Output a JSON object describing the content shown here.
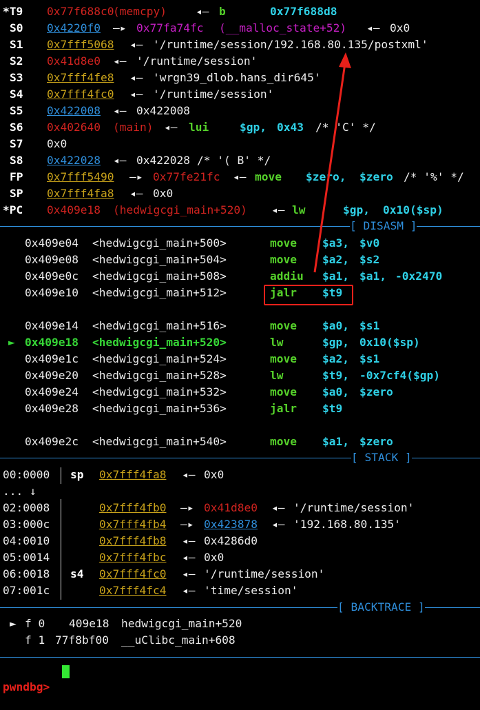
{
  "registers": [
    {
      "name": "*T9",
      "addr": "0x77f688c0",
      "desc": "(memcpy)",
      "arrow": "◂—",
      "instr": "b",
      "target": "0x77f688d8"
    },
    {
      "name": "S0",
      "addr": "0x4220f0",
      "arrow1": "—▸",
      "ptr": "0x77fa74fc",
      "desc": "(__malloc_state+52)",
      "arrow2": "◂—",
      "val": "0x0"
    },
    {
      "name": "S1",
      "addr": "0x7fff5068",
      "arrow": "◂—",
      "val": "'/runtime/session/192.168.80.135/postxml'"
    },
    {
      "name": "S2",
      "addr": "0x41d8e0",
      "arrow": "◂—",
      "val": "'/runtime/session'"
    },
    {
      "name": "S3",
      "addr": "0x7fff4fe8",
      "arrow": "◂—",
      "val": "'wrgn39_dlob.hans_dir645'"
    },
    {
      "name": "S4",
      "addr": "0x7fff4fc0",
      "arrow": "◂—",
      "val": "'/runtime/session'"
    },
    {
      "name": "S5",
      "addr": "0x422008",
      "arrow": "◂—",
      "val": "0x422008"
    },
    {
      "name": "S6",
      "addr": "0x402640",
      "desc": "(main)",
      "arrow": "◂—",
      "instr": "lui",
      "op1": "$gp,",
      "op2": "0x43",
      "comment": "/* 'C' */"
    },
    {
      "name": "S7",
      "val": "0x0"
    },
    {
      "name": "S8",
      "addr": "0x422028",
      "arrow": "◂—",
      "val": "0x422028",
      "comment": "/* '( B' */"
    },
    {
      "name": "FP",
      "addr": "0x7fff5490",
      "arrow1": "—▸",
      "ptr": "0x77fe21fc",
      "arrow2": "◂—",
      "instr": "move",
      "op1": "$zero,",
      "op2": "$zero",
      "comment": "/* '%' */"
    },
    {
      "name": "SP",
      "addr": "0x7fff4fa8",
      "arrow": "◂—",
      "val": "0x0"
    },
    {
      "name": "*PC",
      "addr": "0x409e18",
      "desc": "(hedwigcgi_main+520)",
      "arrow": "◂—",
      "instr": "lw",
      "op1": "$gp,",
      "op2": "0x10($sp)"
    }
  ],
  "sections": {
    "disasm": "[ DISASM ]",
    "stack": "[ STACK ]",
    "backtrace": "[ BACKTRACE ]"
  },
  "disasm": [
    {
      "marker": "",
      "addr": "0x409e04",
      "sym": "<hedwigcgi_main+500>",
      "op": "move",
      "a1": "$a3,",
      "a2": "$v0",
      "a3": ""
    },
    {
      "marker": "",
      "addr": "0x409e08",
      "sym": "<hedwigcgi_main+504>",
      "op": "move",
      "a1": "$a2,",
      "a2": "$s2",
      "a3": ""
    },
    {
      "marker": "",
      "addr": "0x409e0c",
      "sym": "<hedwigcgi_main+508>",
      "op": "addiu",
      "a1": "$a1,",
      "a2": "$a1,",
      "a3": "-0x2470"
    },
    {
      "marker": "",
      "addr": "0x409e10",
      "sym": "<hedwigcgi_main+512>",
      "op": "jalr",
      "a1": "$t9",
      "a2": "",
      "a3": ""
    },
    {
      "marker": "",
      "addr": "0x409e14",
      "sym": "<hedwigcgi_main+516>",
      "op": "move",
      "a1": "$a0,",
      "a2": "$s1",
      "a3": ""
    },
    {
      "marker": "►",
      "addr": "0x409e18",
      "sym": "<hedwigcgi_main+520>",
      "op": "lw",
      "a1": "$gp,",
      "a2": "0x10($sp)",
      "a3": ""
    },
    {
      "marker": "",
      "addr": "0x409e1c",
      "sym": "<hedwigcgi_main+524>",
      "op": "move",
      "a1": "$a2,",
      "a2": "$s1",
      "a3": ""
    },
    {
      "marker": "",
      "addr": "0x409e20",
      "sym": "<hedwigcgi_main+528>",
      "op": "lw",
      "a1": "$t9,",
      "a2": "-0x7cf4($gp)",
      "a3": ""
    },
    {
      "marker": "",
      "addr": "0x409e24",
      "sym": "<hedwigcgi_main+532>",
      "op": "move",
      "a1": "$a0,",
      "a2": "$zero",
      "a3": ""
    },
    {
      "marker": "",
      "addr": "0x409e28",
      "sym": "<hedwigcgi_main+536>",
      "op": "jalr",
      "a1": "$t9",
      "a2": "",
      "a3": ""
    },
    {
      "marker": "",
      "addr": "0x409e2c",
      "sym": "<hedwigcgi_main+540>",
      "op": "move",
      "a1": "$a1,",
      "a2": "$zero",
      "a3": ""
    }
  ],
  "stack": [
    {
      "off": "00:0000",
      "reg": "sp",
      "addr": "0x7fff4fa8",
      "arrow": "◂—",
      "val": "0x0"
    },
    {
      "skip": "... ↓"
    },
    {
      "off": "02:0008",
      "reg": "",
      "addr": "0x7fff4fb0",
      "arrow1": "—▸",
      "ptr": "0x41d8e0",
      "arrow2": "◂—",
      "val": "'/runtime/session'"
    },
    {
      "off": "03:000c",
      "reg": "",
      "addr": "0x7fff4fb4",
      "arrow1": "—▸",
      "ptr": "0x423878",
      "arrow2": "◂—",
      "val": "'192.168.80.135'"
    },
    {
      "off": "04:0010",
      "reg": "",
      "addr": "0x7fff4fb8",
      "arrow": "◂—",
      "val": "0x4286d0"
    },
    {
      "off": "05:0014",
      "reg": "",
      "addr": "0x7fff4fbc",
      "arrow": "◂—",
      "val": "0x0"
    },
    {
      "off": "06:0018",
      "reg": "s4",
      "addr": "0x7fff4fc0",
      "arrow": "◂—",
      "val": "'/runtime/session'"
    },
    {
      "off": "07:001c",
      "reg": "",
      "addr": "0x7fff4fc4",
      "arrow": "◂—",
      "val": "'time/session'"
    }
  ],
  "backtrace": [
    {
      "marker": "►",
      "frame": "f 0",
      "addr": "409e18",
      "sym": "hedwigcgi_main+520"
    },
    {
      "marker": "",
      "frame": "f 1",
      "addr": "77f8bf00",
      "sym": "__uClibc_main+608"
    }
  ],
  "prompt": "pwndbg>",
  "colors": {
    "accent": "#2f8fdc",
    "highlight_box": "#e8201a",
    "arrow": "#e8201a",
    "current": "#36d636"
  }
}
